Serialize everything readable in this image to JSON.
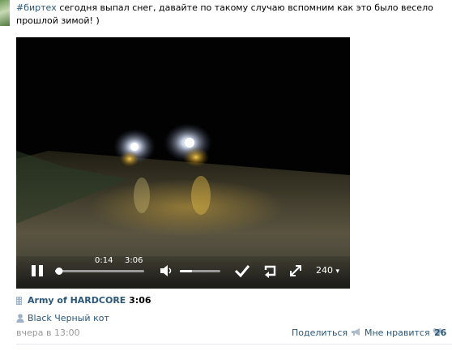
{
  "post": {
    "hashtag": "#биртех",
    "text": " сегодня выпал снег, давайте по такому случаю вспомним как это было весело прошлой зимой! )"
  },
  "player": {
    "current_time": "0:14",
    "total_time": "3:06",
    "progress": 0.045,
    "volume": 0.3,
    "quality": "240",
    "quality_caret": "▾"
  },
  "video": {
    "title": "Army of HARDCORE",
    "duration": "3:06"
  },
  "author": "Black Черный кот",
  "footer": {
    "date": "вчера в 13:00",
    "share_label": "Поделиться",
    "like_label": "Мне нравится",
    "like_count": "26"
  },
  "colors": {
    "link": "#2b587a",
    "muted": "#999999",
    "icon": "#aebdcc"
  },
  "icons": [
    "film-icon",
    "user-icon",
    "megaphone-icon",
    "heart-icon",
    "pause-icon",
    "volume-icon",
    "check-icon",
    "repeat-icon",
    "fullscreen-icon"
  ]
}
